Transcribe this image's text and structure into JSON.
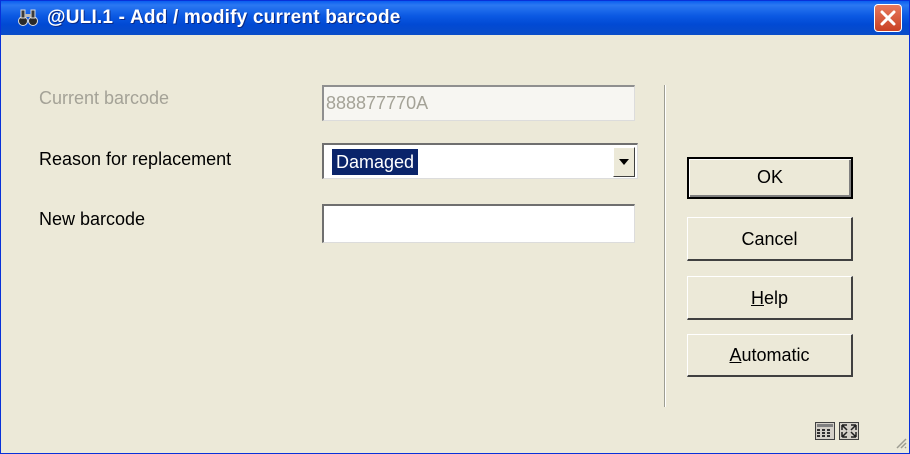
{
  "window": {
    "title": "@ULI.1 - Add / modify current barcode",
    "accent": "#0a58e2"
  },
  "form": {
    "current_barcode": {
      "label": "Current barcode",
      "value": "888877770A",
      "disabled": true
    },
    "reason": {
      "label": "Reason for replacement",
      "value": "Damaged"
    },
    "new_barcode": {
      "label": "New barcode",
      "value": ""
    }
  },
  "buttons": {
    "ok": "OK",
    "cancel": "Cancel",
    "help": {
      "mnemonic": "H",
      "rest": "elp"
    },
    "automatic": {
      "mnemonic": "A",
      "rest": "utomatic"
    }
  },
  "icons": {
    "app": "binoculars-icon",
    "close": "close-icon",
    "dropdown": "chevron-down-icon",
    "calculator": "calculator-icon",
    "maximize": "maximize-icon",
    "resize": "resize-grip-icon"
  }
}
